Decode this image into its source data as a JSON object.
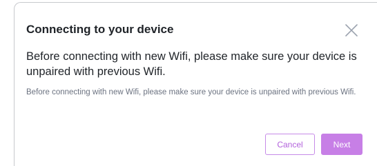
{
  "dialog": {
    "title": "Connecting to your device",
    "close_icon": "close-icon",
    "lead_text": "Before connecting with new Wifi, please make sure your device is unpaired with previous Wifi.",
    "sub_text": "Before connecting with new Wifi, please make sure your device is unpaired with previous Wifi.",
    "buttons": {
      "cancel_label": "Cancel",
      "next_label": "Next"
    }
  },
  "colors": {
    "accent": "#c77fe6",
    "accent_text": "#b261dc",
    "border": "#c7c9cd",
    "title_text": "#1f2328",
    "secondary_text": "#6b7280"
  }
}
